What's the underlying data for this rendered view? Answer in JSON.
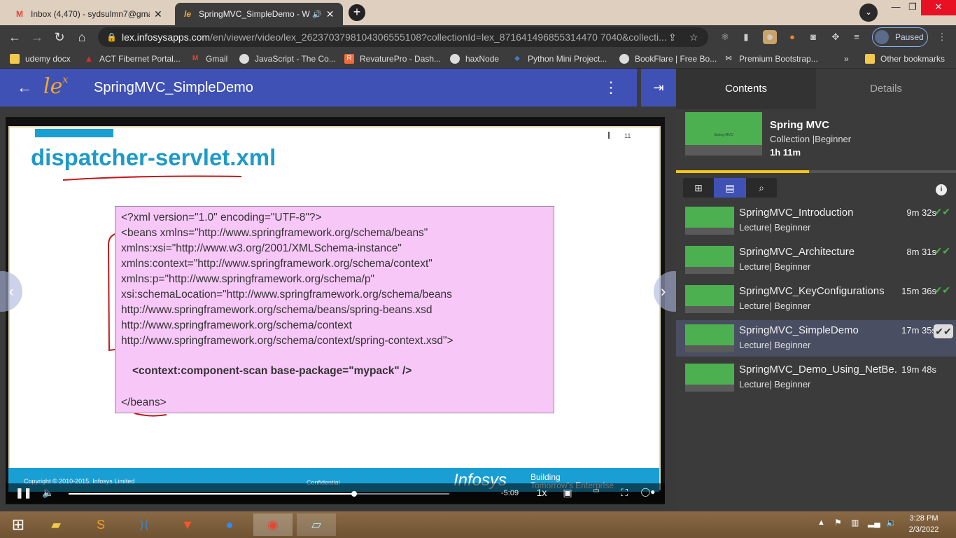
{
  "browser": {
    "tabs": [
      {
        "title": "Inbox (4,470) - sydsulmn7@gmai",
        "close": "✕"
      },
      {
        "title": "SpringMVC_SimpleDemo - W",
        "close": "✕"
      }
    ],
    "new_tab": "+",
    "url_host": "lex.infosysapps.com",
    "url_path": "/en/viewer/video/lex_2623703798104306555108?collectionId=lex_871641496855314470 7040&collecti...",
    "profile_label": "Paused",
    "window_controls": {
      "minimize": "—",
      "restore": "❐",
      "close": "✕"
    },
    "bookmarks": [
      {
        "label": "udemy docx",
        "icon": "folder-icon",
        "color": "#f2c94c"
      },
      {
        "label": "ACT Fibernet Portal...",
        "icon": "act-icon",
        "color": "#d32f2f"
      },
      {
        "label": "Gmail",
        "icon": "gmail-icon",
        "color": "#ea4335"
      },
      {
        "label": "JavaScript - The Co...",
        "icon": "globe-icon",
        "color": "#888888"
      },
      {
        "label": "RevaturePro - Dash...",
        "icon": "revature-icon",
        "color": "#f26b3a"
      },
      {
        "label": "haxNode",
        "icon": "globe-icon",
        "color": "#888888"
      },
      {
        "label": "Python Mini Project...",
        "icon": "python-icon",
        "color": "#3f7cc4"
      },
      {
        "label": "BookFlare | Free Bo...",
        "icon": "globe-icon",
        "color": "#888888"
      },
      {
        "label": "Premium Bootstrap...",
        "icon": "bootstrap-icon",
        "color": "#222222"
      }
    ],
    "more_bookmarks": "»",
    "other_bookmarks": "Other bookmarks"
  },
  "app": {
    "logo": "lex",
    "title": "SpringMVC_SimpleDemo"
  },
  "slide": {
    "page_number": "11",
    "title": "dispatcher-servlet.xml",
    "code_lines": [
      "<?xml version=\"1.0\" encoding=\"UTF-8\"?>",
      "<beans xmlns=\"http://www.springframework.org/schema/beans\"",
      "xmlns:xsi=\"http://www.w3.org/2001/XMLSchema-instance\"",
      "xmlns:context=\"http://www.springframework.org/schema/context\"",
      "xmlns:p=\"http://www.springframework.org/schema/p\"",
      "xsi:schemaLocation=\"http://www.springframework.org/schema/beans",
      "http://www.springframework.org/schema/beans/spring-beans.xsd",
      "http://www.springframework.org/schema/context",
      "http://www.springframework.org/schema/context/spring-context.xsd\">"
    ],
    "component_scan": "<context:component-scan base-package=\"mypack\" />",
    "closing": "</beans>",
    "footer_copyright": "Copyright © 2010-2015, Infosys Limited",
    "footer_confidential": "Confidential",
    "footer_brand": "Infosys",
    "footer_tagline_1": "Building",
    "footer_tagline_2": "Tomorrow's Enterprise"
  },
  "player": {
    "time_remaining": "-5:09",
    "speed": "1x",
    "progress": 0.75
  },
  "panel": {
    "tabs": [
      "Contents",
      "Details"
    ],
    "collection": {
      "title": "Spring MVC",
      "subtitle": "Collection |Beginner",
      "duration": "1h 11m",
      "thumb_text": "Spring MVC"
    },
    "progress": 0.475,
    "lectures": [
      {
        "name": "SpringMVC_Introduction",
        "sub": "Lecture| Beginner",
        "duration": "9m 32s",
        "done": true,
        "active": false
      },
      {
        "name": "SpringMVC_Architecture",
        "sub": "Lecture| Beginner",
        "duration": "8m 31s",
        "done": true,
        "active": false
      },
      {
        "name": "SpringMVC_KeyConfigurations",
        "sub": "Lecture| Beginner",
        "duration": "15m 36s",
        "done": true,
        "active": false
      },
      {
        "name": "SpringMVC_SimpleDemo",
        "sub": "Lecture| Beginner",
        "duration": "17m 35s",
        "done": true,
        "active": true
      },
      {
        "name": "SpringMVC_Demo_Using_NetBe...",
        "sub": "Lecture| Beginner",
        "duration": "19m 48s",
        "done": false,
        "active": false
      }
    ]
  },
  "taskbar": {
    "time": "3:28 PM",
    "date": "2/3/2022"
  }
}
